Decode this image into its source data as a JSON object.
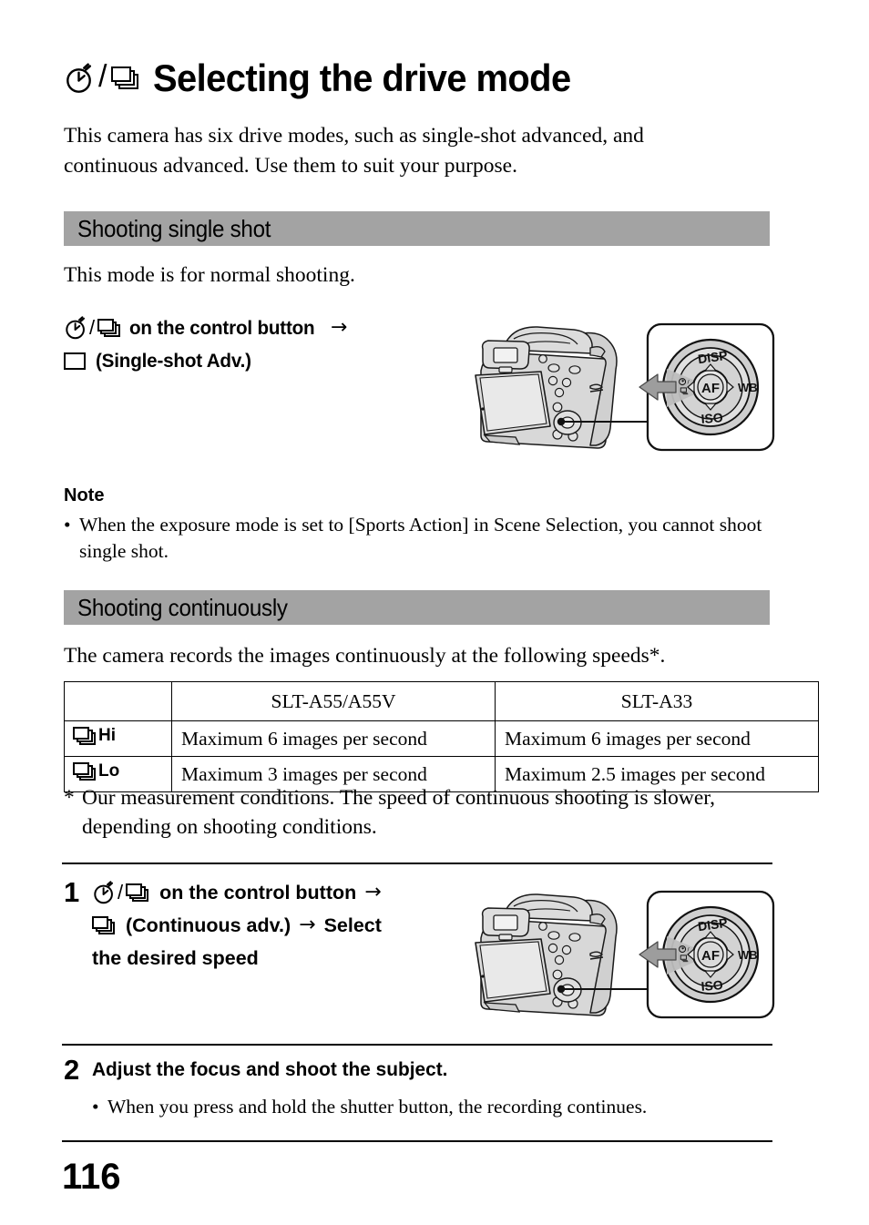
{
  "page": {
    "number": "116"
  },
  "title": {
    "text": "Selecting the drive mode",
    "icon_left": "self-timer-icon",
    "separator": "/",
    "icon_right": "continuous-burst-icon"
  },
  "intro": {
    "text": "This camera has six drive modes, such as single-shot advanced, and continuous advanced. Use them to suit your purpose."
  },
  "sections": [
    {
      "heading": "Shooting single shot",
      "lead": "This mode is for normal shooting."
    },
    {
      "heading": "Shooting continuously",
      "lead": "The camera records the images continuously at the following speeds*."
    }
  ],
  "single_shot_instruction": {
    "line1_text": "on the control button",
    "line1_arrow": "→",
    "line2_text": "(Single-shot Adv.)",
    "icon_line1_left": "self-timer-icon",
    "icon_line1_separator": "/",
    "icon_line1_right": "continuous-burst-icon",
    "icon_line2": "single-shot-frame-icon"
  },
  "note": {
    "heading": "Note",
    "bullet": "•",
    "items": [
      "When the exposure mode is set to [Sports Action] in Scene Selection, you cannot shoot single shot."
    ]
  },
  "speed_table": {
    "headers": [
      "",
      "SLT-A55/A55V",
      "SLT-A33"
    ],
    "rows": [
      {
        "mode_icon": "continuous-burst-icon",
        "mode_label": "Hi",
        "a55": "Maximum 6 images per second",
        "a33": "Maximum 6 images per second"
      },
      {
        "mode_icon": "continuous-burst-icon",
        "mode_label": "Lo",
        "a55": "Maximum 3 images per second",
        "a33": "Maximum 2.5 images per second"
      }
    ]
  },
  "footnote": {
    "marker": "*",
    "text": "Our measurement conditions. The speed of continuous shooting is slower, depending on shooting conditions."
  },
  "steps": [
    {
      "number": "1",
      "line1_text": "on the control button",
      "line1_arrow": "→",
      "line2_text": "(Continuous adv.)",
      "line2_arrow": "→",
      "line2_tail": "Select",
      "line3_text": "the desired speed",
      "icon_line1_left": "self-timer-icon",
      "icon_line1_separator": "/",
      "icon_line1_right": "continuous-burst-icon",
      "icon_line2": "continuous-burst-icon"
    },
    {
      "number": "2",
      "text": "Adjust the focus and shoot the subject.",
      "bullet": "•",
      "notes": [
        "When you press and hold the shutter button, the recording continues."
      ]
    }
  ],
  "control_dial": {
    "top_label": "DISP",
    "right_label": "WB",
    "bottom_label": "ISO",
    "center_label": "AF",
    "left_icon": "drive-mode-icon",
    "arrow_direction": "left"
  },
  "colors": {
    "section_bar": "#a3a3a3",
    "illustration_fill": "#d7d7d7",
    "illustration_light": "#ededed",
    "arrow_gray": "#9a9a9a",
    "text": "#000000",
    "background": "#ffffff"
  }
}
